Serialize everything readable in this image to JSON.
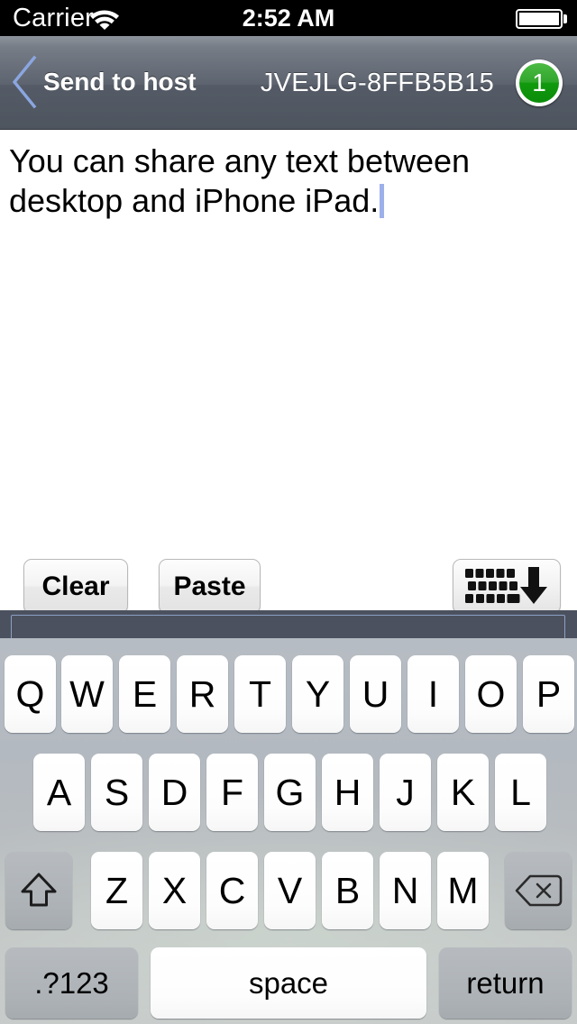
{
  "status_bar": {
    "carrier": "Carrier",
    "wifi_icon": "wifi-icon",
    "time": "2:52 AM",
    "battery_icon": "battery-full-icon"
  },
  "nav_bar": {
    "back_icon": "chevron-left-icon",
    "back_label": "Send to host",
    "session_code": "JVEJLG-8FFB5B15",
    "badge_count": "1",
    "badge_color": "#1a9c14",
    "chevron_color": "#8ba6e0"
  },
  "editor": {
    "text": "You can share any text between desktop and iPhone iPad.",
    "caret_color": "#9db0ea"
  },
  "accessory_toolbar": {
    "clear_label": "Clear",
    "paste_label": "Paste",
    "hide_keyboard_icon": "hide-keyboard-icon"
  },
  "keyboard": {
    "row1": [
      "Q",
      "W",
      "E",
      "R",
      "T",
      "Y",
      "U",
      "I",
      "O",
      "P"
    ],
    "row2": [
      "A",
      "S",
      "D",
      "F",
      "G",
      "H",
      "J",
      "K",
      "L"
    ],
    "row3": [
      "Z",
      "X",
      "C",
      "V",
      "B",
      "N",
      "M"
    ],
    "shift_icon": "shift-up-arrow-icon",
    "delete_icon": "backspace-delete-icon",
    "numeric_label": ".?123",
    "space_label": "space",
    "return_label": "return"
  }
}
